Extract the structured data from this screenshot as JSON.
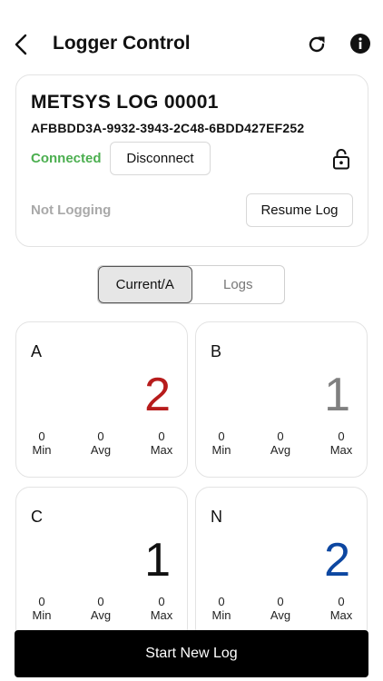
{
  "header": {
    "title": "Logger Control",
    "back_icon": "chevron-left-icon",
    "refresh_icon": "refresh-icon",
    "info_icon": "info-icon"
  },
  "device": {
    "name": "METSYS LOG 00001",
    "id": "AFBBDD3A-9932-3943-2C48-6BDD427EF252",
    "connection_status": "Connected",
    "disconnect_label": "Disconnect",
    "lock_icon": "unlocked-padlock-icon",
    "logging_status": "Not Logging",
    "resume_label": "Resume Log"
  },
  "tabs": [
    {
      "label": "Current/A",
      "active": true
    },
    {
      "label": "Logs",
      "active": false
    }
  ],
  "phases": [
    {
      "label": "A",
      "value": "2",
      "color": "#b71c1c",
      "min": "0",
      "avg": "0",
      "max": "0"
    },
    {
      "label": "B",
      "value": "1",
      "color": "#808080",
      "min": "0",
      "avg": "0",
      "max": "0"
    },
    {
      "label": "C",
      "value": "1",
      "color": "#111111",
      "min": "0",
      "avg": "0",
      "max": "0"
    },
    {
      "label": "N",
      "value": "2",
      "color": "#0d47a1",
      "min": "0",
      "avg": "0",
      "max": "0"
    }
  ],
  "stat_labels": {
    "min": "Min",
    "avg": "Avg",
    "max": "Max"
  },
  "start_label": "Start New Log",
  "colors": {
    "connected": "#4caf50",
    "muted": "#a9a9a9",
    "primary_button": "#000000"
  }
}
